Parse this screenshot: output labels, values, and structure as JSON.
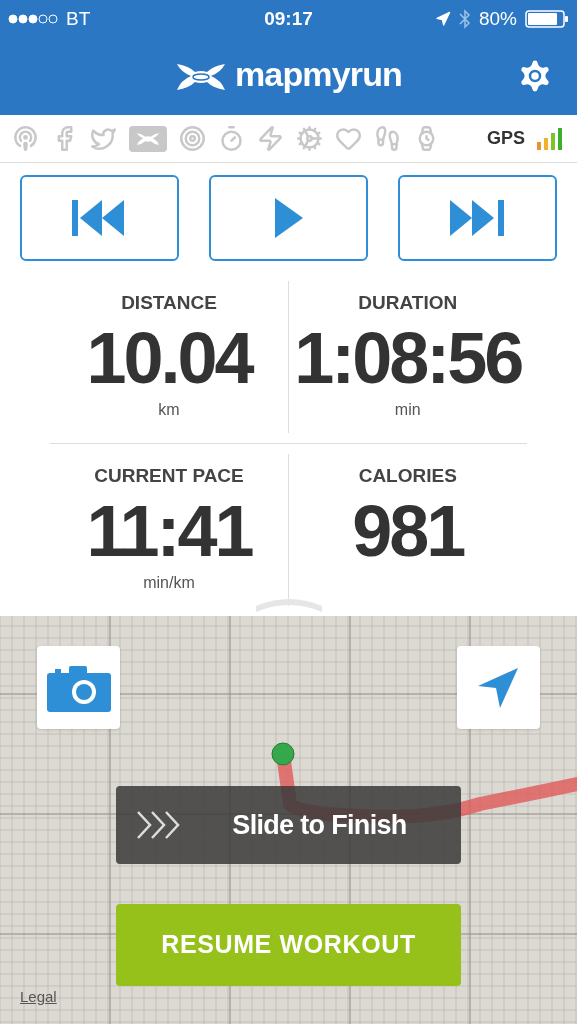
{
  "status_bar": {
    "carrier": "BT",
    "time": "09:17",
    "battery": "80%"
  },
  "header": {
    "title": "mapmyrun"
  },
  "gps": {
    "label": "GPS"
  },
  "stats": [
    {
      "label": "DISTANCE",
      "value": "10.04",
      "unit": "km"
    },
    {
      "label": "DURATION",
      "value": "1:08:56",
      "unit": "min"
    },
    {
      "label": "CURRENT PACE",
      "value": "11:41",
      "unit": "min/km"
    },
    {
      "label": "CALORIES",
      "value": "981"
    }
  ],
  "slider": {
    "label": "Slide to Finish"
  },
  "resume_button": {
    "label": "RESUME WORKOUT"
  },
  "legal_link": {
    "label": "Legal"
  }
}
